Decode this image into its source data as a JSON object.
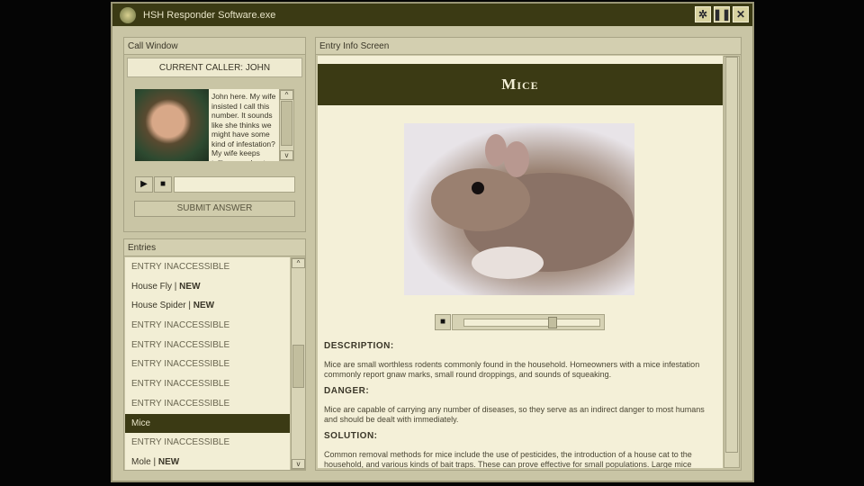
{
  "window": {
    "title": "HSH Responder Software.exe",
    "buttons": [
      "settings",
      "pause",
      "close"
    ]
  },
  "call_window": {
    "title": "Call Window",
    "caller": "CURRENT CALLER: JOHN",
    "message": "John here. My wife insisted I call this number. It sounds like she thinks we might have some kind of infestation? My wife keeps telling me about specks of dirt or",
    "submit": "SUBMIT ANSWER",
    "play": "▶",
    "stop": "■"
  },
  "entries": {
    "title": "Entries",
    "items": [
      {
        "label": "ENTRY INACCESSIBLE",
        "new": ""
      },
      {
        "label": "House Fly | ",
        "new": "NEW"
      },
      {
        "label": "House Spider | ",
        "new": "NEW"
      },
      {
        "label": "ENTRY INACCESSIBLE",
        "new": ""
      },
      {
        "label": "ENTRY INACCESSIBLE",
        "new": ""
      },
      {
        "label": "ENTRY INACCESSIBLE",
        "new": ""
      },
      {
        "label": "ENTRY INACCESSIBLE",
        "new": ""
      },
      {
        "label": "ENTRY INACCESSIBLE",
        "new": ""
      },
      {
        "label": "Mice",
        "new": ""
      },
      {
        "label": "ENTRY INACCESSIBLE",
        "new": ""
      },
      {
        "label": "Mole | ",
        "new": "NEW"
      }
    ],
    "selected": "Mice"
  },
  "entry_info": {
    "title": "Entry Info Screen",
    "name": "Mice",
    "audio_progress": 0.65,
    "description_label": "DESCRIPTION:",
    "description": "Mice are small worthless rodents commonly found in the household. Homeowners with a mice infestation commonly report gnaw marks, small round droppings, and sounds of squeaking.",
    "danger_label": "DANGER:",
    "danger": "Mice are capable of carrying any number of diseases, so they serve as an indirect danger to most humans and should be dealt with immediately.",
    "solution_label": "SOLUTION:",
    "solution": "Common removal methods for mice include the use of pesticides, the introduction of a house cat to the household, and various kinds of bait traps. These can prove effective for small populations. Large mice"
  }
}
